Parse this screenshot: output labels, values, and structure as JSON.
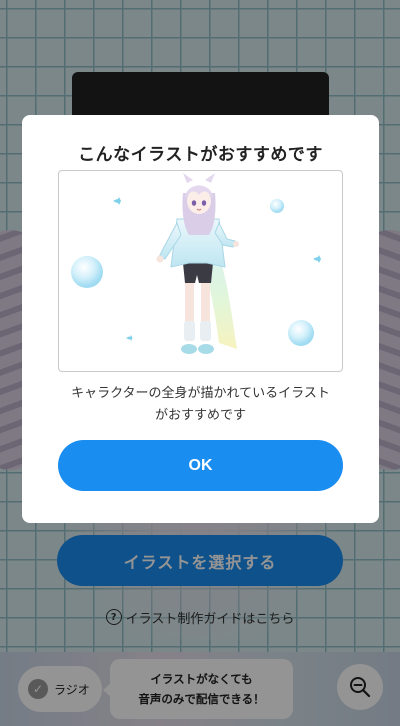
{
  "background": {
    "select_button_label": "イラストを選択する",
    "guide_link_label": "イラスト制作ガイドはこちら",
    "radio_label": "ラジオ",
    "tooltip_line1": "イラストがなくても",
    "tooltip_line2": "音声のみで配信できる！"
  },
  "modal": {
    "title": "こんなイラストがおすすめです",
    "description": "キャラクターの全身が描かれているイラスト\nがおすすめです",
    "ok_label": "OK"
  },
  "icons": {
    "help": "question-circle-icon",
    "radio_check": "check-circle-icon",
    "zoom": "zoom-out-icon"
  },
  "colors": {
    "primary": "#1a8df0",
    "overlay": "rgba(0,0,0,0.42)",
    "grid": "#8fbec6"
  }
}
